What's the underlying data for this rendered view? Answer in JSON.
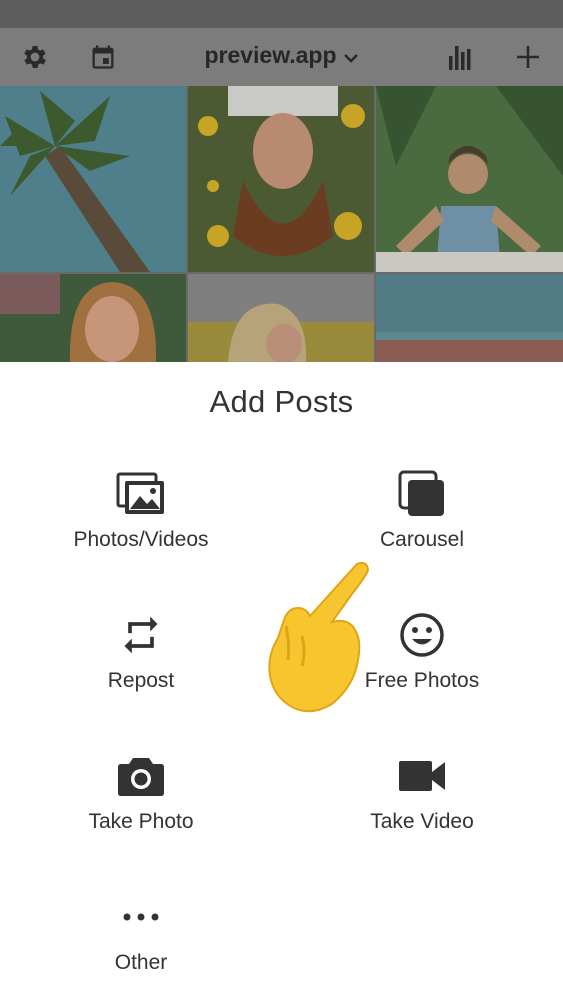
{
  "topbar": {
    "title": "preview.app",
    "settings_icon": "gear-icon",
    "calendar_icon": "calendar-icon",
    "stats_icon": "bar-chart-icon",
    "add_icon": "plus-icon"
  },
  "grid": {
    "tiles": [
      "palm-tree-photo",
      "girl-flowers-photo",
      "woman-palms-photo",
      "smiling-girl-photo",
      "blonde-field-photo",
      "sea-horizon-photo"
    ]
  },
  "sheet": {
    "title": "Add Posts",
    "options": {
      "photos_videos": "Photos/Videos",
      "carousel": "Carousel",
      "repost": "Repost",
      "free_photos": "Free Photos",
      "take_photo": "Take Photo",
      "take_video": "Take Video",
      "other": "Other"
    }
  },
  "colors": {
    "icon": "#333333",
    "topbar_dim": "#7c7c7c",
    "hand": "#f7c62f"
  }
}
